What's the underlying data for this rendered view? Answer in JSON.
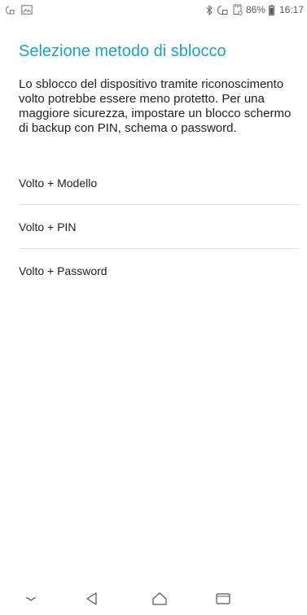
{
  "status_bar": {
    "battery_text": "86%",
    "time_text": "16:17",
    "left_icons": [
      "screenshot-capture-icon",
      "image-notification-icon"
    ],
    "right_icons": [
      "bluetooth-icon",
      "data-saver-icon",
      "sd-card-icon",
      "battery-icon"
    ]
  },
  "page": {
    "title": "Selezione metodo di sblocco",
    "description": "Lo sblocco del dispositivo tramite riconoscimento volto potrebbe essere meno protetto. Per una maggiore sicurezza, impostare un blocco schermo di backup con PIN, schema o password."
  },
  "options": [
    {
      "label": "Volto + Modello"
    },
    {
      "label": "Volto + PIN"
    },
    {
      "label": "Volto + Password"
    }
  ],
  "nav_bar": {
    "buttons": [
      "collapse-icon",
      "back-icon",
      "home-icon",
      "recents-icon"
    ]
  },
  "colors": {
    "accent": "#1aa4c4",
    "text": "#222222",
    "divider": "#e2e2e2",
    "status_icons": "#6b6b6b"
  }
}
